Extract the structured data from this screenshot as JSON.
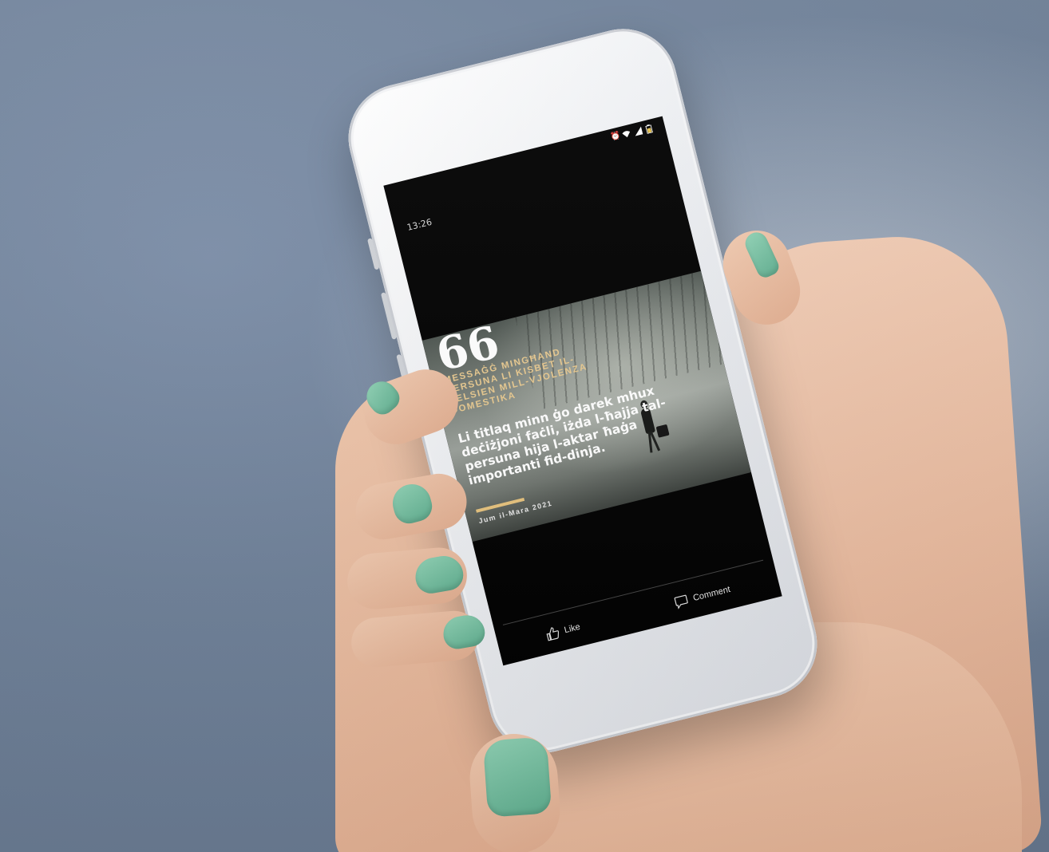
{
  "status_bar": {
    "time": "13:26",
    "icons": [
      "alarm-icon",
      "wifi-icon",
      "signal-icon",
      "battery-icon"
    ]
  },
  "post": {
    "quote_mark": "66",
    "heading": "MESSAĠĠ MINGĦAND PERSUNA LI KISBET IL-ĦELSIEN MILL-VJOLENZA DOMESTIKA",
    "body": "Li titlaq minn ġo darek mhux deċiżjoni faċli, iżda l-ħajja tal-persuna hija l-aktar ħaġa importanti fid-dinja.",
    "date": "Jum il-Mara 2021"
  },
  "actions": {
    "like_label": "Like",
    "comment_label": "Comment"
  },
  "colors": {
    "accent": "#e6c27d",
    "nail": "#7cc3a6",
    "skin": "#ecc1a7",
    "background": "#6f8199"
  }
}
